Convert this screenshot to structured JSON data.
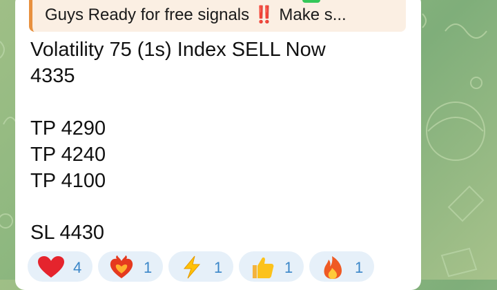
{
  "reply_preview": {
    "text": "Guys Ready for free signals ‼️  Make s...",
    "accent_color": "#e8913f"
  },
  "message": {
    "headline": "Volatility 75 (1s) Index SELL Now",
    "entry": "4335",
    "take_profits": [
      "TP 4290",
      "TP 4240",
      "TP 4100"
    ],
    "stop_loss": "SL 4430"
  },
  "reactions": [
    {
      "icon": "red-heart-icon",
      "count": "4"
    },
    {
      "icon": "heart-on-fire-icon",
      "count": "1"
    },
    {
      "icon": "lightning-icon",
      "count": "1"
    },
    {
      "icon": "thumbs-up-icon",
      "count": "1"
    },
    {
      "icon": "fire-icon",
      "count": "1"
    }
  ],
  "colors": {
    "bubble": "#ffffff",
    "reaction_bg": "#e6f0f9",
    "reaction_count": "#3a86c8",
    "wallpaper": "#8db77f"
  }
}
